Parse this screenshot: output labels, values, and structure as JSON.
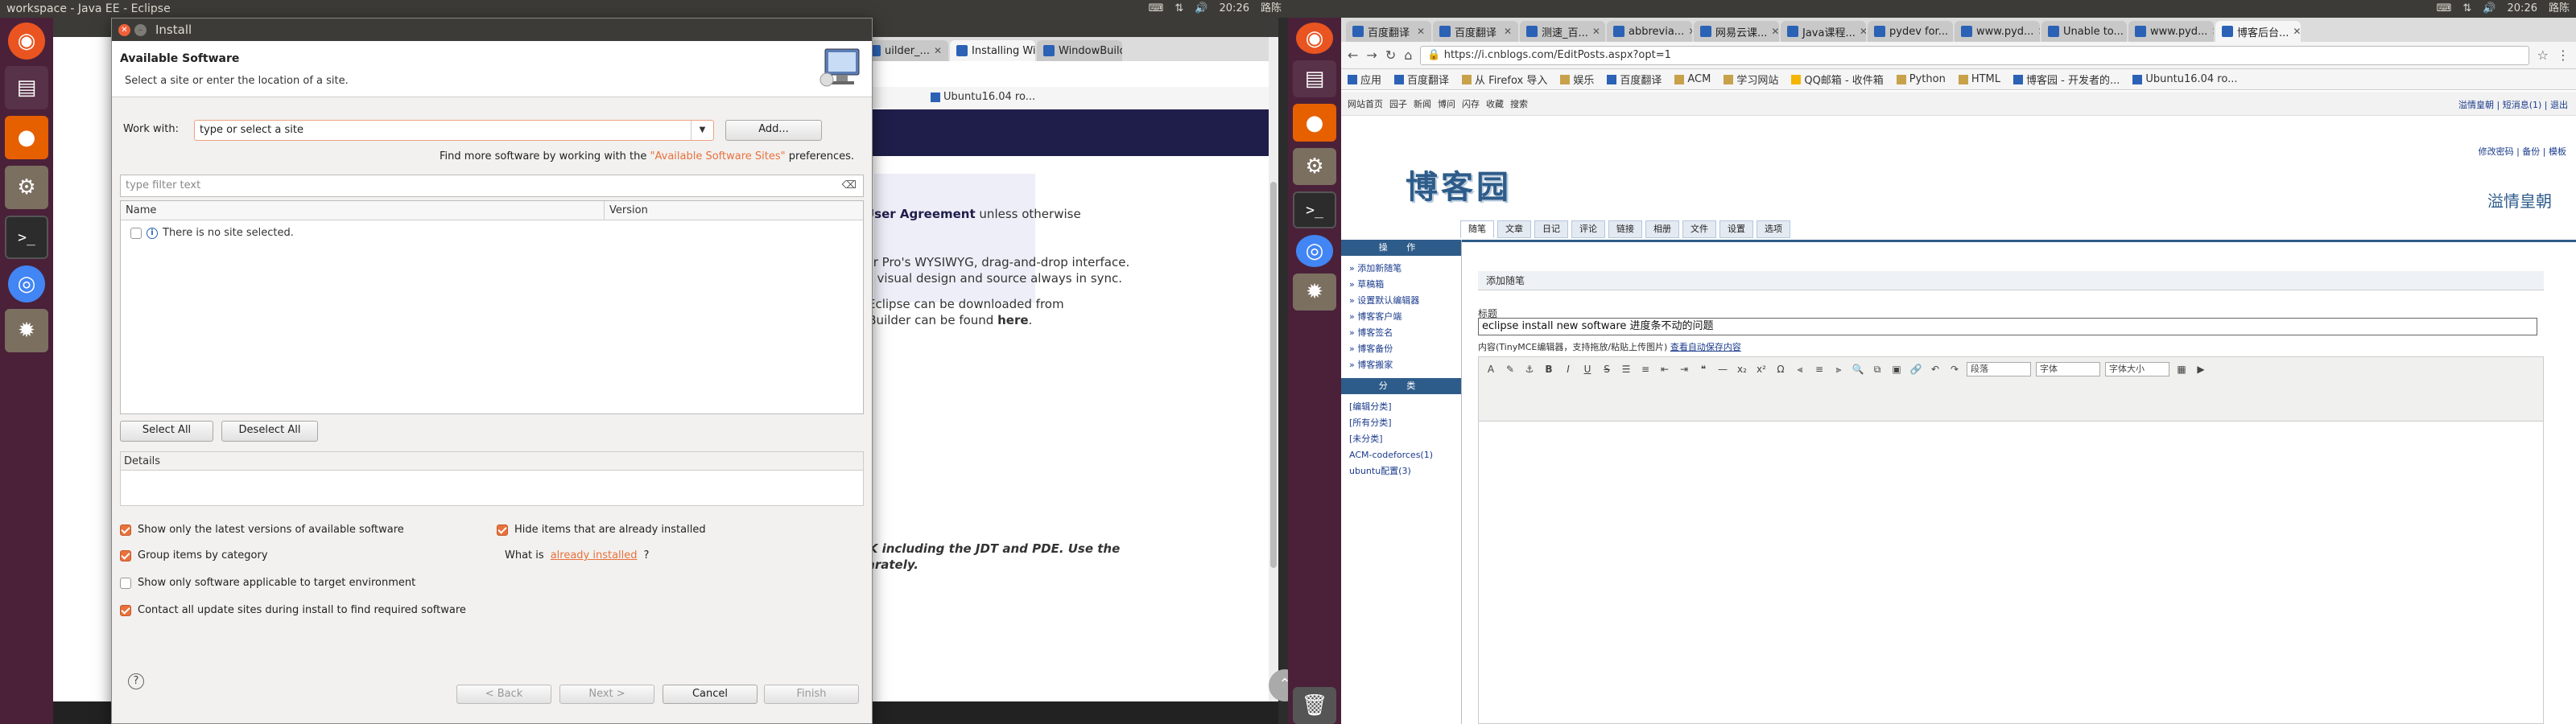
{
  "left": {
    "topbar_title": "workspace - Java EE - Eclipse",
    "tray": {
      "clock": "20:26",
      "item": "路陈"
    },
    "browser_tabs": [
      "uilder_...",
      "Installing Win...",
      "WindowBuilder..."
    ],
    "bookmarks": [
      "Ubuntu16.04 ro..."
    ],
    "welcome": {
      "line1_bold": "User Agreement",
      "line1_rest": " unless otherwise",
      "line2": "der Pro's WYSIWYG, drag-and-drop interface.",
      "line3": "he visual design and source always in sync.",
      "line4": "Eclipse can be downloaded from",
      "line5_pre": "wBuilder can be found ",
      "line5_bold": "here",
      "line6": "OK including the JDT and PDE. Use the",
      "line7": "parately."
    },
    "scroll_up_icon": "up-arrow"
  },
  "dialog": {
    "title": "Install",
    "heading": "Available Software",
    "subheading": "Select a site or enter the location of a site.",
    "work_with_label": "Work with:",
    "work_with_placeholder": "type or select a site",
    "add_button": "Add...",
    "find_more_pre": "Find more software by working with the ",
    "find_more_link": "\"Available Software Sites\"",
    "find_more_post": " preferences.",
    "filter_placeholder": "type filter text",
    "columns": {
      "name": "Name",
      "version": "Version"
    },
    "empty_row": "There is no site selected.",
    "select_all": "Select All",
    "deselect_all": "Deselect All",
    "details_label": "Details",
    "options": {
      "latest_versions": {
        "label": "Show only the latest versions of available software",
        "checked": true
      },
      "hide_installed": {
        "label": "Hide items that are already installed",
        "checked": true
      },
      "group_by_category": {
        "label": "Group items by category",
        "checked": true
      },
      "applicable_only": {
        "label": "Show only software applicable to target environment",
        "checked": false
      },
      "contact_all": {
        "label": "Contact all update sites during install to find required software",
        "checked": true
      }
    },
    "what_is_pre": "What is ",
    "what_is_link": "already installed",
    "what_is_post": "?",
    "buttons": {
      "back": "< Back",
      "next": "Next >",
      "cancel": "Cancel",
      "finish": "Finish"
    },
    "help": "?"
  },
  "right": {
    "tray": {
      "clock": "20:26",
      "item": "路陈"
    },
    "browser_tabs": [
      "百度翻译",
      "百度翻译",
      "测速_百...",
      "abbrevia...",
      "网易云课...",
      "Java课程...",
      "pydev for...",
      "www.pyd...",
      "Unable to...",
      "www.pyd...",
      "博客后台..."
    ],
    "url": "https://i.cnblogs.com/EditPosts.aspx?opt=1",
    "bookmarks": [
      "应用",
      "百度翻译",
      "从 Firefox 导入",
      "娱乐",
      "百度翻译",
      "ACM",
      "学习网站",
      "QQ邮箱 - 收件箱",
      "Python",
      "HTML",
      "博客园 - 开发者的...",
      "Ubuntu16.04 ro..."
    ],
    "cnb_nav": [
      "网站首页",
      "园子",
      "新闻",
      "博问",
      "闪存",
      "收藏",
      "搜索"
    ],
    "cnb_topright": "溢情皇朝 | 短消息(1) | 退出",
    "cnb_links": "修改密码 | 备份 | 模板",
    "logo": "博客园",
    "username": "溢情皇朝",
    "tabs": [
      "随笔",
      "文章",
      "日记",
      "评论",
      "链接",
      "相册",
      "文件",
      "设置",
      "选项"
    ],
    "side_head1": "操 作",
    "side_ops": [
      "» 添加新随笔",
      "» 草稿箱",
      "» 设置默认编辑器",
      "» 博客客户端",
      "» 博客签名",
      "» 博客备份",
      "» 博客搬家"
    ],
    "side_head2": "分 类",
    "side_cats": [
      "[编辑分类]",
      "[所有分类]",
      "[未分类]",
      "ACM-codeforces(1)",
      "ubuntu配置(3)"
    ],
    "add_post": "添加随笔",
    "title_label": "标题",
    "title_value": "eclipse install new software 进度条不动的问题",
    "content_label": "内容(TinyMCE编辑器，支持拖放/粘贴上传图片)",
    "autosave_link": "查看自动保存内容",
    "editor_selects": [
      "段落",
      "字体",
      "字体大小"
    ]
  }
}
